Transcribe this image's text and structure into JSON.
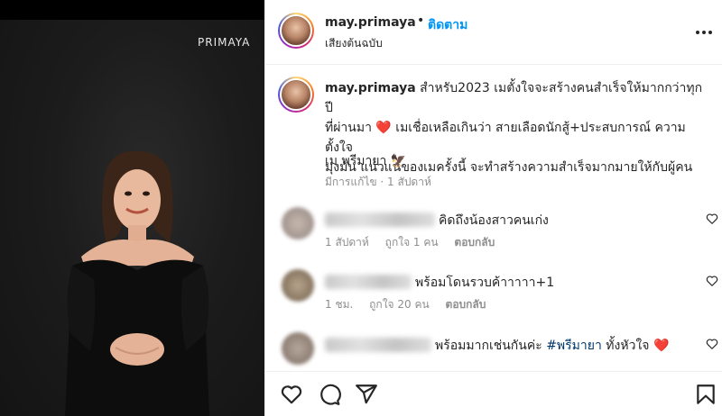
{
  "media": {
    "brand_text": "PRIMAYA"
  },
  "header": {
    "username": "may.primaya",
    "dot": "•",
    "follow_label": "ติดตาม",
    "audio_label": "เสียงต้นฉบับ"
  },
  "caption": {
    "username": "may.primaya",
    "line1": "สำหรับ2023 เมตั้งใจจะสร้างคนสำเร็จให้มากกว่าทุกปี",
    "line2a": "ที่ผ่านมา",
    "heart": "❤️",
    "line2b": "เมเชื่อเหลือเกินว่า สายเลือดนักสู้+ประสบการณ์ ความตั้งใจ",
    "line3": "มุ่งมั่น แน่วแน่ของเมครั้งนี้ จะทำสร้างความสำเร็จมากมายให้กับผู้คน",
    "signature": "เม พรีมายา",
    "emoji": "🦅",
    "meta": "มีการแก้ไข · 1 สัปดาห์"
  },
  "comments": [
    {
      "text": "คิดถึงน้องสาวคนเก่ง",
      "time": "1 สัปดาห์",
      "likes": "ถูกใจ 1 คน",
      "reply": "ตอบกลับ"
    },
    {
      "text": "พร้อมโดนรวบค้าาาาา+1",
      "time": "1 ชม.",
      "likes": "ถูกใจ 20 คน",
      "reply": "ตอบกลับ"
    },
    {
      "text_a": "พร้อมมากเช่นกันค่ะ",
      "tag": "#พรีมายา",
      "text_b": "ทั้งหัวใจ",
      "heart": "❤️"
    }
  ],
  "icons": {
    "like": "heart-icon",
    "comment": "comment-icon",
    "share": "share-icon",
    "save": "bookmark-icon"
  },
  "colors": {
    "follow": "#0095f6",
    "heart": "#ed4956",
    "hashtag": "#00376b",
    "muted": "#8e8e8e"
  }
}
